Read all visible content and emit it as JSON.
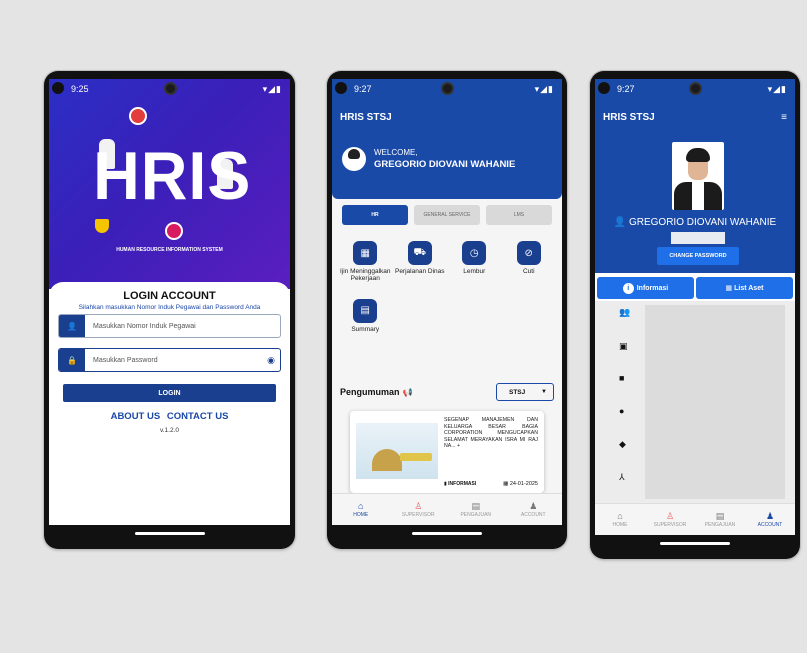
{
  "phone1": {
    "time": "9:25",
    "hero_title": "HRIS",
    "hero_subtitle": "HUMAN RESOURCE INFORMATION SYSTEM",
    "login_title": "LOGIN ACCOUNT",
    "login_subtitle": "Silahkan masukkan Nomor Induk Pegawai dan Password Anda",
    "nip_placeholder": "Masukkan Nomor Induk Pegawai",
    "password_placeholder": "Masukkan Password",
    "login_button": "LOGIN",
    "about_link": "ABOUT US",
    "contact_link": "CONTACT US",
    "version": "v.1.2.0"
  },
  "phone2": {
    "time": "9:27",
    "app_title": "HRIS STSJ",
    "welcome_label": "WELCOME,",
    "user_name": "GREGORIO DIOVANI WAHANIE",
    "tabs": [
      "HR",
      "GENERAL SERVICE",
      "LMS"
    ],
    "menu": [
      {
        "label": "Ijin Meninggalkan Pekerjaan",
        "icon": "calendar-icon"
      },
      {
        "label": "Perjalanan Dinas",
        "icon": "car-icon"
      },
      {
        "label": "Lembur",
        "icon": "clock-plus-icon"
      },
      {
        "label": "Cuti",
        "icon": "leave-icon"
      },
      {
        "label": "Summary",
        "icon": "summary-icon"
      }
    ],
    "announcement_title": "Pengumuman",
    "announcement_filter": "STSJ",
    "announcement": {
      "text": "SEGENAP MANAJEMEN DAN KELUARGA BESAR BAGIA CORPORATION MENGUCAPKAN SELAMAT MERAYAKAN ISRA MI RAJ NA... +",
      "category": "INFORMASI",
      "date": "24-01-2025"
    },
    "bottom_nav": [
      "HOME",
      "SUPERVISOR",
      "PENGAJUAN",
      "ACCOUNT"
    ]
  },
  "phone3": {
    "time": "9:27",
    "app_title": "HRIS STSJ",
    "user_name": "GREGORIO DIOVANI WAHANIE",
    "change_password": "CHANGE PASSWORD",
    "tab_info": "Informasi",
    "tab_assets": "List Aset",
    "bottom_nav": [
      "HOME",
      "SUPERVISOR",
      "PENGAJUAN",
      "ACCOUNT"
    ]
  },
  "colors": {
    "primary": "#1a4aa8",
    "accent": "#1e6fe8",
    "hero_start": "#2b2fc6",
    "hero_end": "#5b1ec0"
  }
}
